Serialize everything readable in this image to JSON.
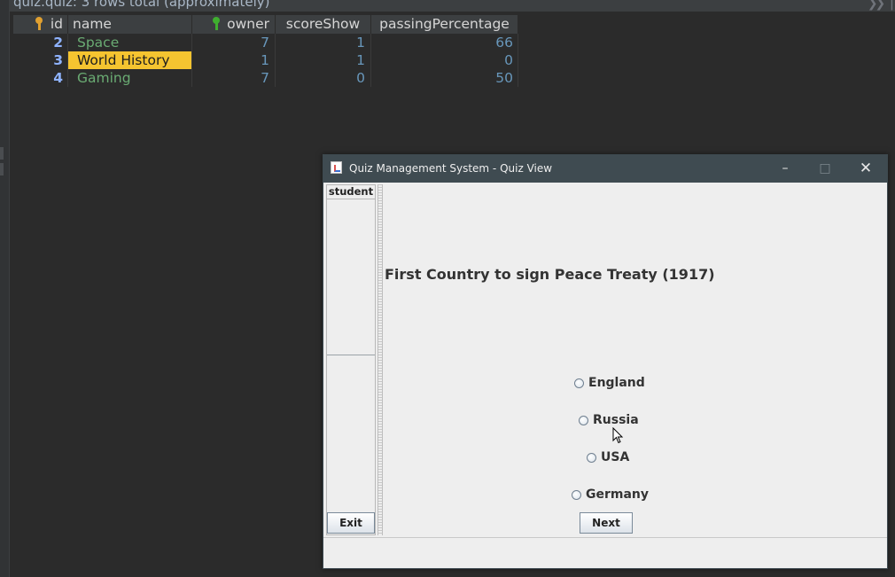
{
  "db": {
    "tab_title": "quiz.quiz: 3 rows total (approximately)",
    "columns": [
      {
        "key": "id",
        "label": "id",
        "icon": "primary-key-icon"
      },
      {
        "key": "name",
        "label": "name"
      },
      {
        "key": "owner",
        "label": "owner",
        "icon": "foreign-key-icon"
      },
      {
        "key": "scoreShow",
        "label": "scoreShow"
      },
      {
        "key": "passingPercentage",
        "label": "passingPercentage"
      }
    ],
    "rows": [
      {
        "id": "2",
        "name": "Space",
        "owner": "7",
        "scoreShow": "1",
        "passingPercentage": "66"
      },
      {
        "id": "3",
        "name": "World History",
        "owner": "1",
        "scoreShow": "1",
        "passingPercentage": "0"
      },
      {
        "id": "4",
        "name": "Gaming",
        "owner": "7",
        "scoreShow": "0",
        "passingPercentage": "50"
      }
    ],
    "selected_cell": {
      "row": 1,
      "column": "name"
    },
    "colors": {
      "selected": "#f5c430",
      "name_text": "#6aab73",
      "number_text": "#6897bb"
    }
  },
  "window": {
    "title": "Quiz Management System - Quiz View",
    "controls": {
      "minimize": "–",
      "maximize": "□",
      "close": "✕"
    },
    "sidebar": {
      "header": "student"
    },
    "exit_label": "Exit",
    "next_label": "Next",
    "question": "First Country to sign Peace Treaty (1917)",
    "options": [
      "England",
      "Russia",
      "USA",
      "Germany"
    ]
  }
}
